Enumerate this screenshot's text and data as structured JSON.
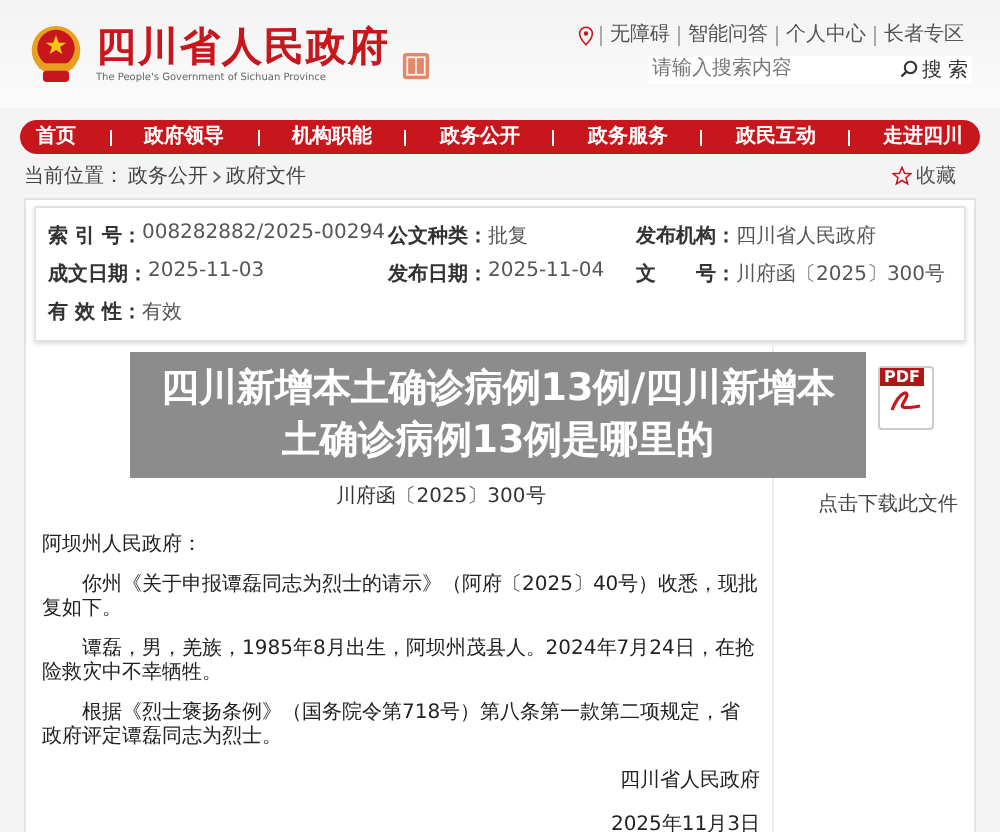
{
  "header": {
    "title": "四川省人民政府",
    "subtitle": "The People's Government of Sichuan Province",
    "top_links": [
      "无障碍",
      "智能问答",
      "个人中心",
      "长者专区"
    ],
    "search": {
      "placeholder": "请输入搜索内容",
      "button": "搜 索"
    }
  },
  "nav": [
    "首页",
    "政府领导",
    "机构职能",
    "政务公开",
    "政务服务",
    "政民互动",
    "走进四川"
  ],
  "breadcrumb": {
    "label": "当前位置：",
    "items": [
      "政务公开",
      "政府文件"
    ]
  },
  "favorite": "收藏",
  "info": [
    {
      "label": "索 引 号：",
      "value": "008282882/2025-00294"
    },
    {
      "label": "公文种类：",
      "value": "批复"
    },
    {
      "label": "发布机构：",
      "value": "四川省人民政府"
    },
    {
      "label": "成文日期：",
      "value": "2025-11-03"
    },
    {
      "label": "发布日期：",
      "value": "2025-11-04"
    },
    {
      "label": "文　　号：",
      "value": "川府函〔2025〕300号"
    },
    {
      "label": "有 效 性：",
      "value": "有效"
    }
  ],
  "document": {
    "number": "川府函〔2025〕300号",
    "paragraphs": [
      {
        "kind": "salutation",
        "text": "阿坝州人民政府："
      },
      {
        "kind": "body",
        "text": "你州《关于申报谭磊同志为烈士的请示》（阿府〔2025〕40号）收悉，现批复如下。"
      },
      {
        "kind": "body",
        "text": "谭磊，男，羌族，1985年8月出生，阿坝州茂县人。2024年7月24日，在抢险救灾中不幸牺牲。"
      },
      {
        "kind": "body",
        "text": "根据《烈士褒扬条例》（国务院令第718号）第八条第一款第二项规定，省政府评定谭磊同志为烈士。"
      },
      {
        "kind": "signature",
        "text": "四川省人民政府"
      },
      {
        "kind": "signature",
        "text": "2025年11月3日"
      }
    ]
  },
  "download": {
    "badge": "PDF",
    "label": "点击下载此文件"
  },
  "overlay_title": "四川新增本土确诊病例13例/四川新增本土确诊病例13例是哪里的"
}
